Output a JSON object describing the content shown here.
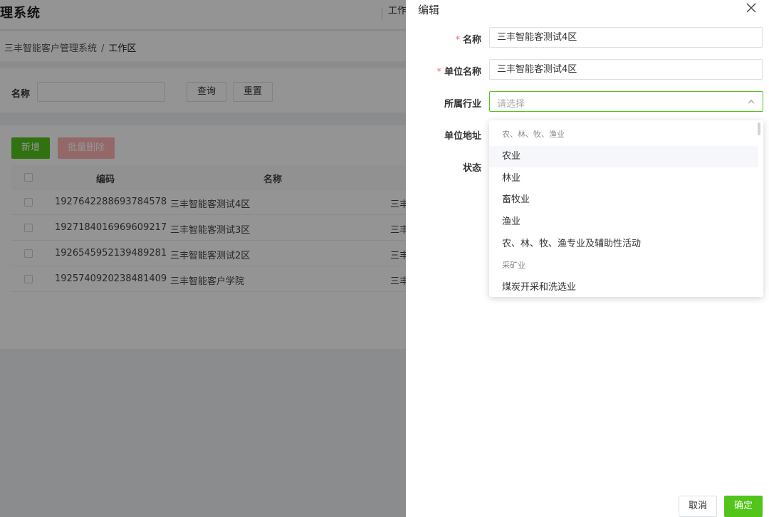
{
  "app": {
    "title": "理系统",
    "nav_link": "工作"
  },
  "breadcrumb": {
    "root": "三丰智能客户管理系统",
    "separator": "/",
    "current": "工作区"
  },
  "search": {
    "label": "名称",
    "query_button": "查询",
    "reset_button": "重置"
  },
  "toolbar": {
    "add_button": "新增",
    "batch_delete_button": "批量删除"
  },
  "table": {
    "columns": [
      "编码",
      "名称"
    ],
    "rows": [
      {
        "code": "1927642288693784578",
        "name": "三丰智能客测试4区",
        "extra": "三丰"
      },
      {
        "code": "1927184016969609217",
        "name": "三丰智能客测试3区",
        "extra": "三丰"
      },
      {
        "code": "1926545952139489281",
        "name": "三丰智能客测试2区",
        "extra": "三丰"
      },
      {
        "code": "1925740920238481409",
        "name": "三丰智能客户学院",
        "extra": "三丰"
      }
    ]
  },
  "drawer": {
    "title": "编辑",
    "required_mark": "*",
    "fields": {
      "name_label": "名称",
      "name_value": "三丰智能客测试4区",
      "unit_label": "单位名称",
      "unit_value": "三丰智能客测试4区",
      "industry_label": "所属行业",
      "industry_placeholder": "请选择",
      "address_label": "单位地址",
      "status_label": "状态"
    },
    "dropdown": {
      "options": [
        {
          "label": "农、林、牧、渔业",
          "group": true
        },
        {
          "label": "农业",
          "group": false,
          "hover": true
        },
        {
          "label": "林业",
          "group": false
        },
        {
          "label": "畜牧业",
          "group": false
        },
        {
          "label": "渔业",
          "group": false
        },
        {
          "label": "农、林、牧、渔专业及辅助性活动",
          "group": false
        },
        {
          "label": "采矿业",
          "group": true
        },
        {
          "label": "煤炭开采和洗选业",
          "group": false
        }
      ]
    },
    "cancel_button": "取消",
    "confirm_button": "确定"
  },
  "colors": {
    "primary": "#52c41a",
    "danger_light": "#ffb3b3",
    "required": "#f56c6c"
  }
}
